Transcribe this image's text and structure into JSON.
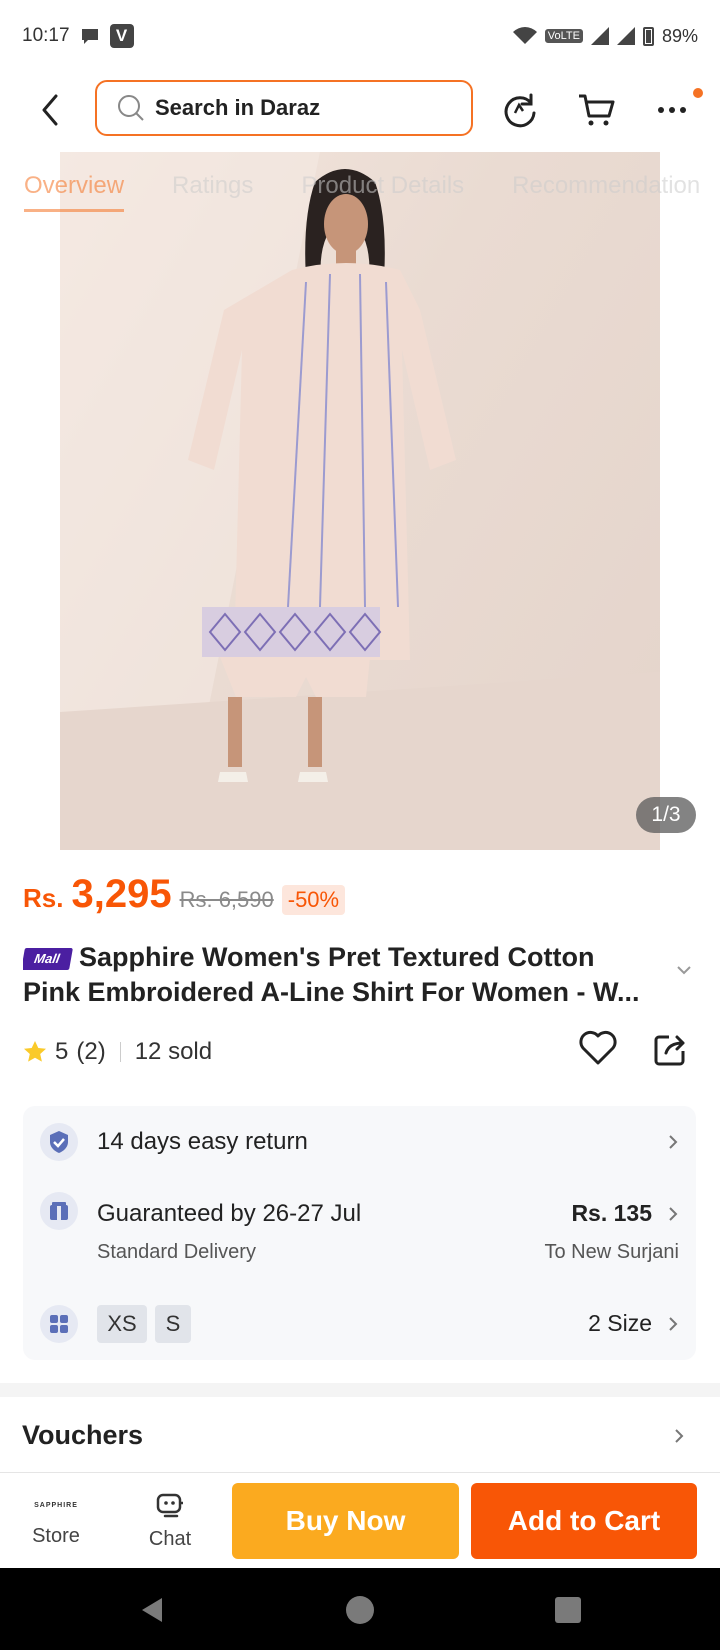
{
  "status_bar": {
    "time": "10:17",
    "v_badge": "V",
    "volte": "VoLTE",
    "battery": "89%"
  },
  "search": {
    "placeholder": "Search in Daraz"
  },
  "tabs": [
    "Overview",
    "Ratings",
    "Product Details",
    "Recommendation"
  ],
  "gallery": {
    "counter": "1/3"
  },
  "price": {
    "currency": "Rs.",
    "current": "3,295",
    "original": "Rs. 6,590",
    "discount": "-50%"
  },
  "product": {
    "mall_badge": "Mall",
    "title_line1": "Sapphire Women's Pret Textured Cotton",
    "title_line2": "Pink Embroidered A-Line Shirt For Women - W..."
  },
  "rating": {
    "score": "5",
    "count": "(2)",
    "sold": "12 sold"
  },
  "info": {
    "returns": "14 days easy return",
    "delivery_title": "Guaranteed by 26-27 Jul",
    "delivery_type": "Standard Delivery",
    "delivery_fee": "Rs. 135",
    "delivery_to": "To New Surjani",
    "sizes": [
      "XS",
      "S"
    ],
    "size_count": "2 Size"
  },
  "vouchers": {
    "label": "Vouchers"
  },
  "bottom_bar": {
    "store_logo": "SAPPHIRE",
    "store_label": "Store",
    "chat_label": "Chat",
    "buy_now": "Buy Now",
    "add_to_cart": "Add to Cart"
  },
  "colors": {
    "accent": "#f85606",
    "search_border": "#f57224",
    "buy_now": "#fbaa1f",
    "mall": "#4b1fa1"
  }
}
